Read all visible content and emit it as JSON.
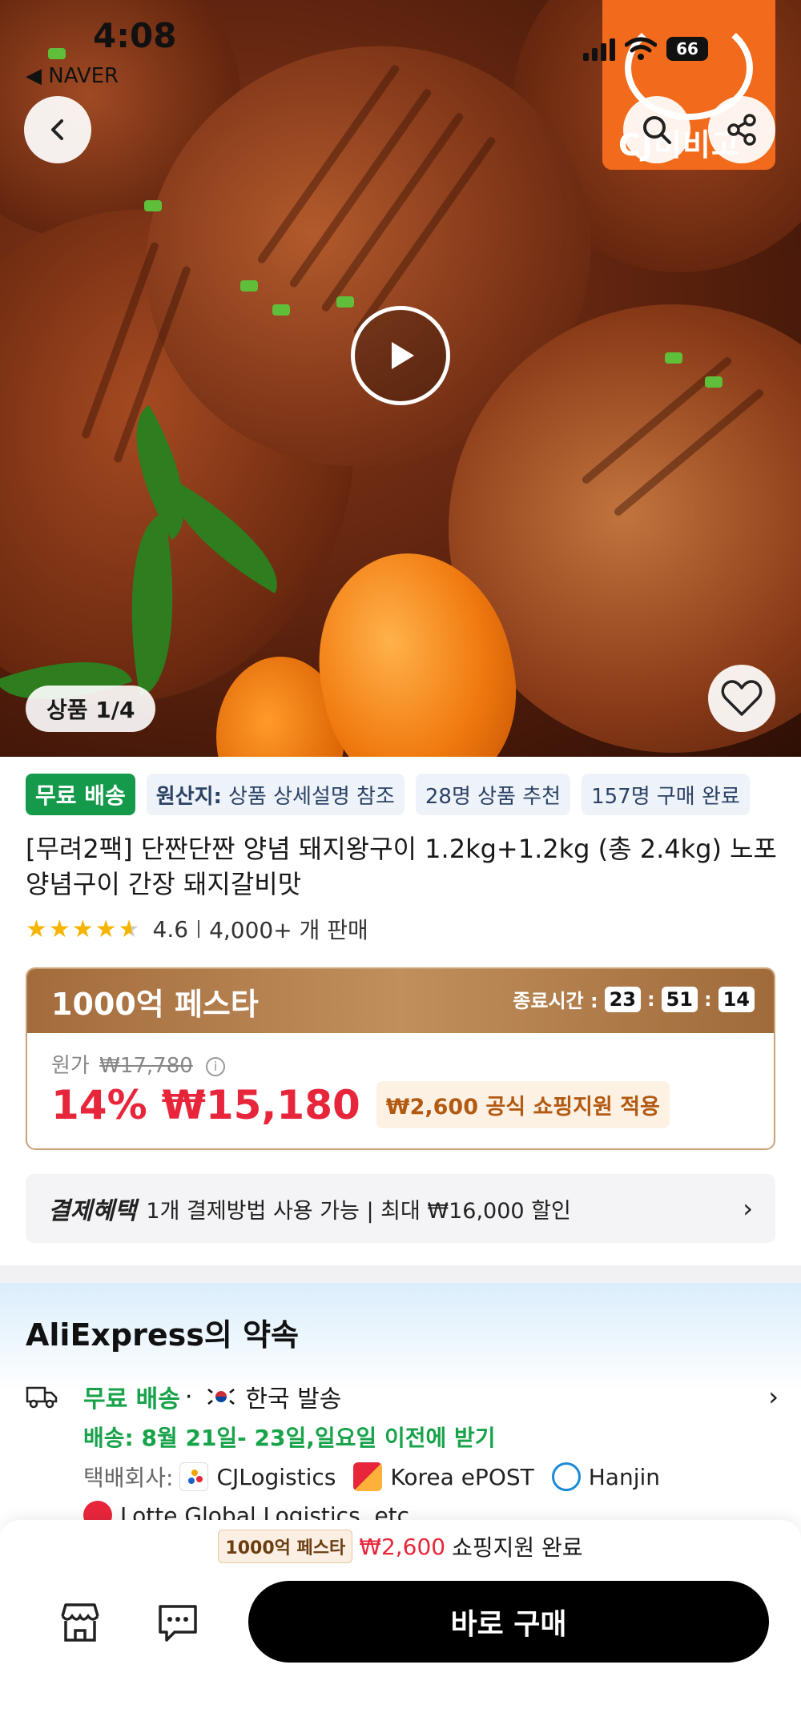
{
  "status_bar": {
    "time": "4:08",
    "back_app": "◀ NAVER",
    "battery": "66"
  },
  "hero": {
    "brand_text": "CJ비비고",
    "image_counter": "상품 1/4"
  },
  "tags": {
    "free_shipping": "무료 배송",
    "origin_label": "원산지:",
    "origin_value": "상품 상세설명 참조",
    "recommend": "28명 상품 추천",
    "purchased": "157명 구매 완료"
  },
  "product": {
    "title": "[무려2팩] 단짠단짠 양념 돼지왕구이 1.2kg+1.2kg (총 2.4kg) 노포양념구이 간장 돼지갈비맛",
    "rating": "4.6",
    "rating_value": 4.6,
    "sold": "4,000+ 개 판매"
  },
  "festa": {
    "title": "1000억 페스타",
    "end_label": "종료시간 :",
    "hours": "23",
    "minutes": "51",
    "seconds": "14",
    "original_label": "원가",
    "original_price": "₩17,780",
    "discount": "14%",
    "price": "₩15,180",
    "support": "₩2,600 공식 쇼핑지원 적용"
  },
  "payment": {
    "label": "결제혜택",
    "text": "1개 결제방법 사용 가능 | 최대 ₩16,000 할인"
  },
  "promise": {
    "title": "AliExpress의 약속",
    "free_shipping": "무료 배송",
    "dot": "·",
    "from": "한국 발송",
    "delivery": "배송: 8월 21일- 23일,일요일 이전에 받기",
    "courier_label": "택배회사:",
    "couriers": [
      "CJLogistics",
      "Korea ePOST",
      "Hanjin",
      "Lotte Global Logistics, etc"
    ]
  },
  "bottom_bar": {
    "badge": "1000억 페스타",
    "amount": "₩2,600",
    "text": "쇼핑지원 완료",
    "buy_now": "바로 구매"
  },
  "colors": {
    "accent_red": "#e8263b",
    "green": "#18a34a",
    "free_tag": "#159a4b",
    "festa_gold": "#b07a46"
  }
}
